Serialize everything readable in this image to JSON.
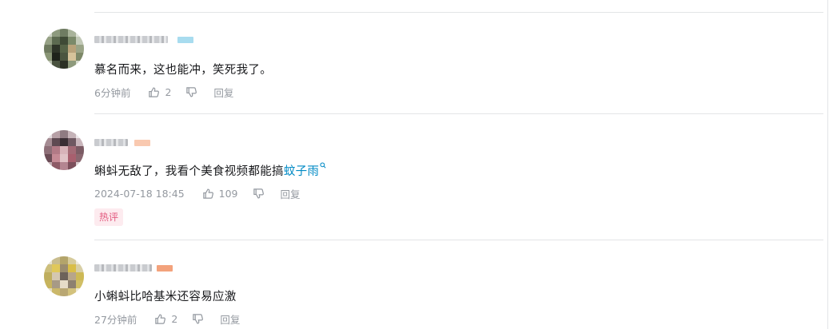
{
  "comments": [
    {
      "content": "慕名而来，这也能冲，笑死我了。",
      "time": "6分钟前",
      "likes": "2",
      "reply_label": "回复",
      "level_color": "#a8dcef"
    },
    {
      "content_prefix": "蝌蚪无敌了，我看个美食视频都能搞",
      "keyword": "蚊子雨",
      "time": "2024-07-18 18:45",
      "likes": "109",
      "reply_label": "回复",
      "badge": "热评",
      "level_color": "#f9c9b0"
    },
    {
      "content": "小蝌蚪比哈基米还容易应激",
      "time": "27分钟前",
      "likes": "2",
      "reply_label": "回复",
      "level_color": "#f3a27c"
    }
  ],
  "colors": {
    "accent": "#008ac5",
    "meta": "#9499a0",
    "badge_text": "#e35a7f",
    "badge_bg": "#fdebef"
  }
}
